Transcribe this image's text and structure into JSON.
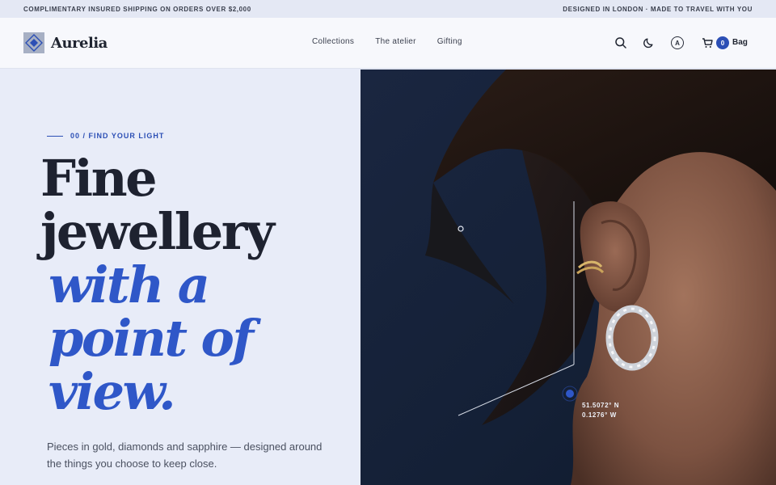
{
  "topbar": {
    "left_text": "COMPLIMENTARY INSURED SHIPPING ON ORDERS OVER $2,000",
    "right_text": "DESIGNED IN LONDON · MADE TO TRAVEL WITH YOU"
  },
  "brand": {
    "name": "Aurelia",
    "logo_icon": "diamond-logo-icon"
  },
  "nav": {
    "items": [
      {
        "label": "Collections"
      },
      {
        "label": "The atelier"
      },
      {
        "label": "Gifting"
      }
    ]
  },
  "actions": {
    "search_icon": "search-icon",
    "theme_icon": "moon-icon",
    "account_letter": "A",
    "bag_icon": "bag-icon",
    "bag_count": "0",
    "bag_label": "Bag"
  },
  "hero": {
    "eyebrow": "00 / FIND YOUR LIGHT",
    "headline_dark": [
      "Fine",
      "jewellery"
    ],
    "headline_accent": [
      "with a",
      "point of",
      "view."
    ],
    "lede": "Pieces in gold, diamonds and sapphire — designed around the things you choose to keep close.",
    "coord_lat": "51.5072° N",
    "coord_lon": "0.1276° W"
  },
  "colors": {
    "accent": "#2f57c8",
    "background": "#e8ecf8",
    "text": "#1e2230",
    "hero_bg": "#16223a"
  }
}
